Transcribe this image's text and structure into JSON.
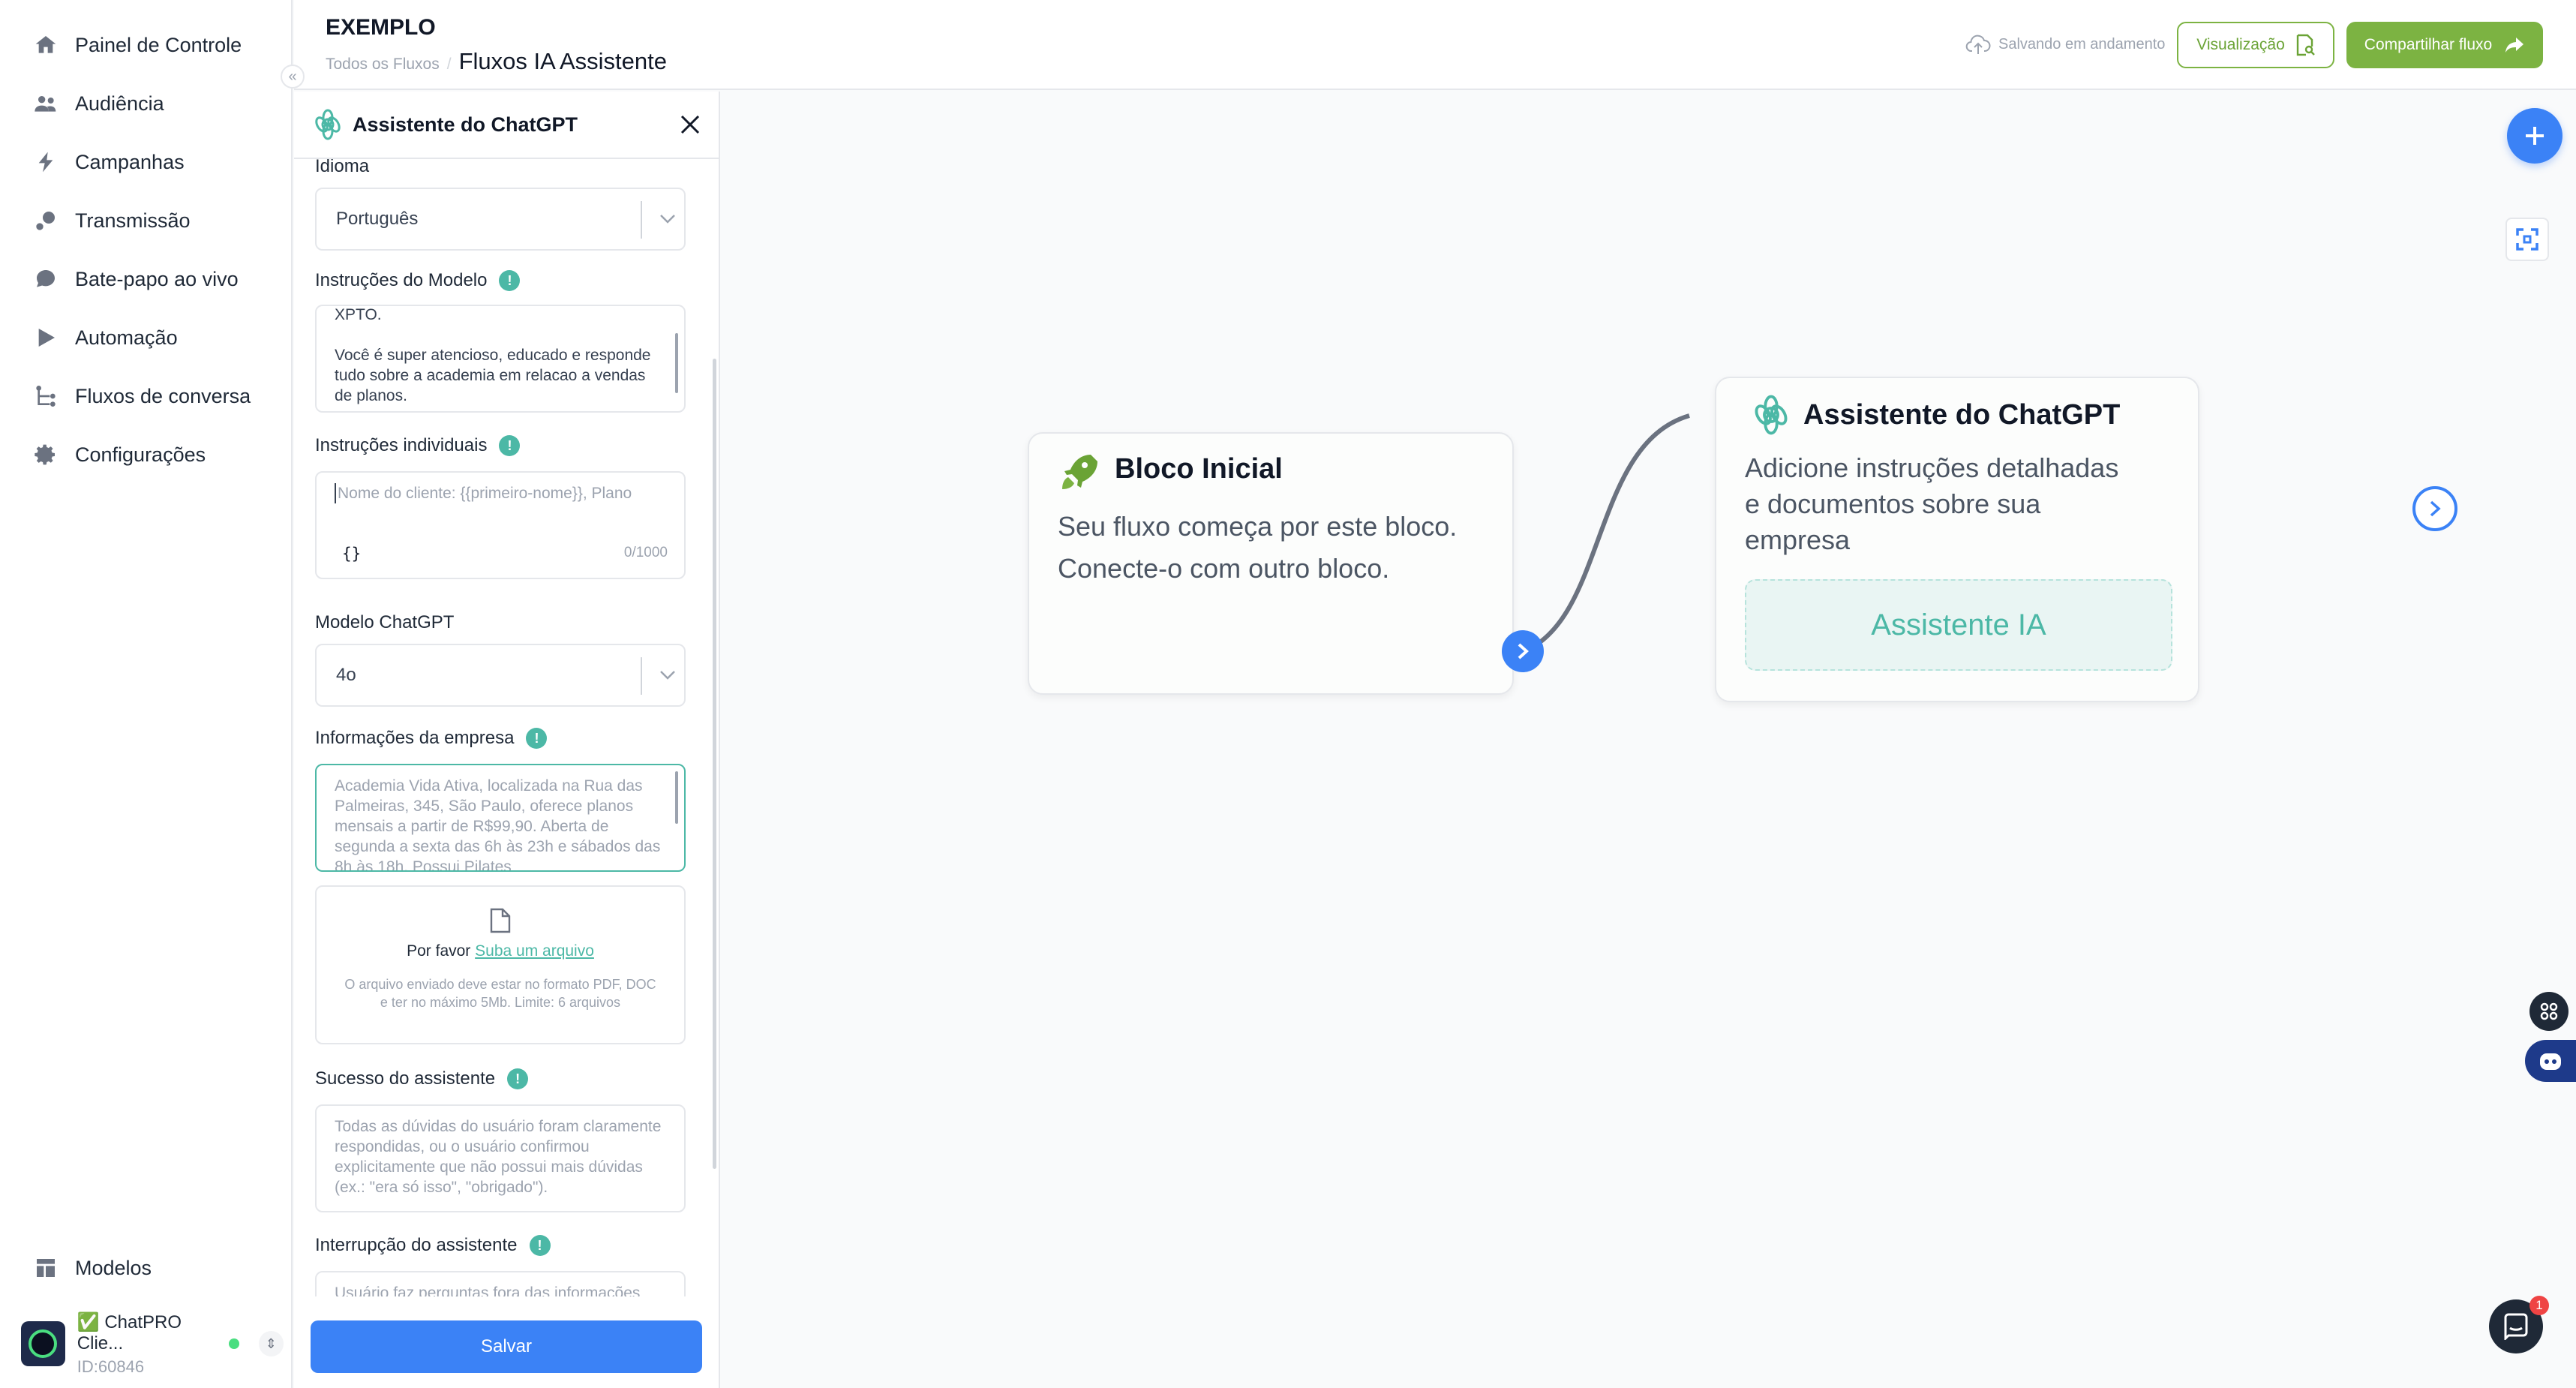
{
  "nav": {
    "items": [
      {
        "label": "Painel de Controle",
        "icon": "home-icon"
      },
      {
        "label": "Audiência",
        "icon": "users-icon"
      },
      {
        "label": "Campanhas",
        "icon": "lightning-icon"
      },
      {
        "label": "Transmissão",
        "icon": "broadcast-icon"
      },
      {
        "label": "Bate-papo ao vivo",
        "icon": "chat-bubble-icon"
      },
      {
        "label": "Automação",
        "icon": "play-icon"
      },
      {
        "label": "Fluxos de conversa",
        "icon": "flow-icon"
      },
      {
        "label": "Configurações",
        "icon": "gear-icon"
      }
    ],
    "models": {
      "label": "Modelos",
      "icon": "templates-icon"
    },
    "account": {
      "name": "✅ ChatPRO Clie...",
      "id": "ID:60846"
    }
  },
  "header": {
    "org": "EXEMPLO",
    "breadcrumb": "Todos os Fluxos",
    "breadcrumb_sep": "/",
    "flow_title": "Fluxos IA Assistente",
    "saving_status": "Salvando em andamento",
    "preview_label": "Visualização",
    "share_label": "Compartilhar fluxo"
  },
  "panel": {
    "title": "Assistente do ChatGPT",
    "language": {
      "label": "Idioma",
      "value": "Português"
    },
    "model_instructions": {
      "label": "Instruções do Modelo",
      "value": "XPTO.\n\nVocê é super atencioso, educado e responde tudo sobre a academia em relacao a vendas de planos."
    },
    "individual_instructions": {
      "label": "Instruções individuais",
      "placeholder": "Nome do cliente: {{primeiro-nome}}, Plano",
      "braces": "{}",
      "counter": "0/1000"
    },
    "chatgpt_model": {
      "label": "Modelo ChatGPT",
      "value": "4o"
    },
    "company_info": {
      "label": "Informações da empresa",
      "value": "Academia Vida Ativa, localizada na Rua das Palmeiras, 345, São Paulo, oferece planos mensais a partir de R$99,90. Aberta de segunda a sexta das 6h às 23h e sábados das 8h às 18h. Possui Pilates"
    },
    "upload": {
      "prefix": "Por favor",
      "link": "Suba um arquivo",
      "hint": "O arquivo enviado deve estar no formato PDF, DOC e ter no máximo 5Mb. Limite: 6 arquivos"
    },
    "assistant_success": {
      "label": "Sucesso do assistente",
      "placeholder": "Todas as dúvidas do usuário foram claramente respondidas, ou o usuário confirmou explicitamente que não possui mais dúvidas (ex.: \"era só isso\", \"obrigado\")."
    },
    "assistant_interruption": {
      "label": "Interrupção do assistente",
      "placeholder": "Usuário faz perguntas fora das informações"
    },
    "save_label": "Salvar"
  },
  "canvas": {
    "start_node": {
      "title": "Bloco Inicial",
      "body_line1": "Seu fluxo começa por este bloco.",
      "body_line2": "Conecte-o com outro bloco."
    },
    "ai_node": {
      "title": "Assistente do ChatGPT",
      "body_line1": "Adicione instruções detalhadas",
      "body_line2": "e documentos sobre sua",
      "body_line3": "empresa",
      "slot_label": "Assistente IA"
    },
    "chat_badge": "1"
  },
  "colors": {
    "primary_blue": "#3b82f6",
    "brand_green": "#7cb342",
    "teal": "#4cb8a6",
    "badge_red": "#ef4444"
  }
}
